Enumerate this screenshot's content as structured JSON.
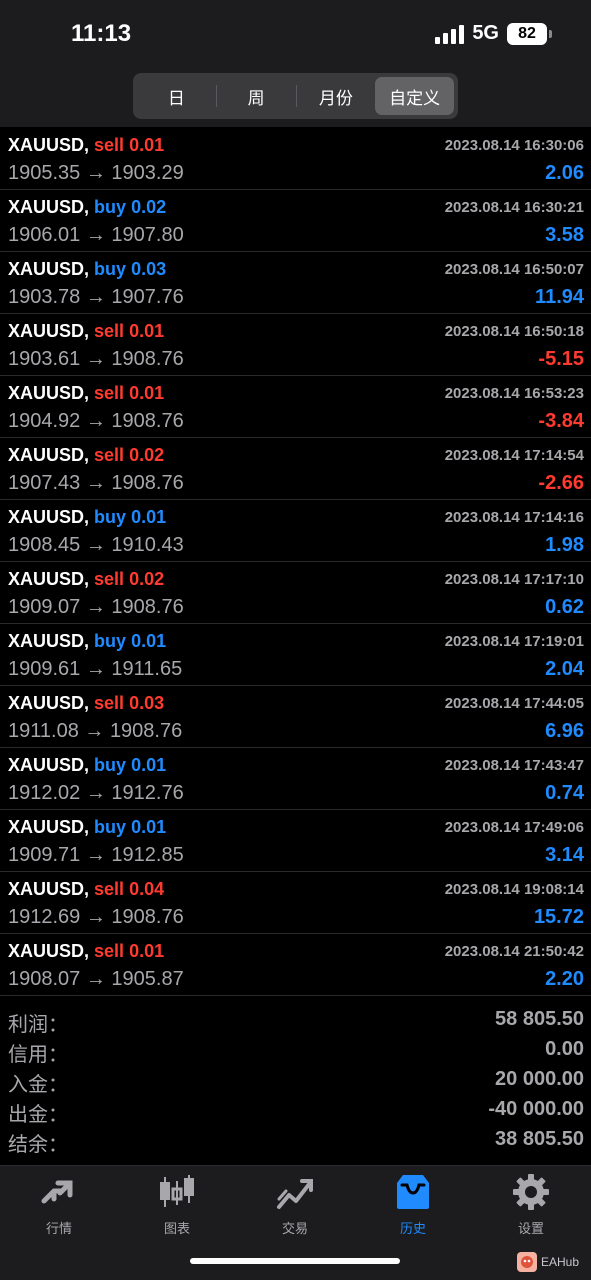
{
  "status": {
    "time": "11:13",
    "network": "5G",
    "battery": "82"
  },
  "segments": [
    {
      "label": "日",
      "active": false
    },
    {
      "label": "周",
      "active": false
    },
    {
      "label": "月份",
      "active": false
    },
    {
      "label": "自定义",
      "active": true
    }
  ],
  "trades": [
    {
      "symbol": "XAUUSD,",
      "side": "sell",
      "volume": "0.01",
      "time": "2023.08.14 16:30:06",
      "open": "1905.35",
      "arrow": "→",
      "close": "1903.29",
      "profit": "2.06",
      "profit_sign": "pos"
    },
    {
      "symbol": "XAUUSD,",
      "side": "buy",
      "volume": "0.02",
      "time": "2023.08.14 16:30:21",
      "open": "1906.01",
      "arrow": "→",
      "close": "1907.80",
      "profit": "3.58",
      "profit_sign": "pos"
    },
    {
      "symbol": "XAUUSD,",
      "side": "buy",
      "volume": "0.03",
      "time": "2023.08.14 16:50:07",
      "open": "1903.78",
      "arrow": "→",
      "close": "1907.76",
      "profit": "11.94",
      "profit_sign": "pos"
    },
    {
      "symbol": "XAUUSD,",
      "side": "sell",
      "volume": "0.01",
      "time": "2023.08.14 16:50:18",
      "open": "1903.61",
      "arrow": "→",
      "close": "1908.76",
      "profit": "-5.15",
      "profit_sign": "neg"
    },
    {
      "symbol": "XAUUSD,",
      "side": "sell",
      "volume": "0.01",
      "time": "2023.08.14 16:53:23",
      "open": "1904.92",
      "arrow": "→",
      "close": "1908.76",
      "profit": "-3.84",
      "profit_sign": "neg"
    },
    {
      "symbol": "XAUUSD,",
      "side": "sell",
      "volume": "0.02",
      "time": "2023.08.14 17:14:54",
      "open": "1907.43",
      "arrow": "→",
      "close": "1908.76",
      "profit": "-2.66",
      "profit_sign": "neg"
    },
    {
      "symbol": "XAUUSD,",
      "side": "buy",
      "volume": "0.01",
      "time": "2023.08.14 17:14:16",
      "open": "1908.45",
      "arrow": "→",
      "close": "1910.43",
      "profit": "1.98",
      "profit_sign": "pos"
    },
    {
      "symbol": "XAUUSD,",
      "side": "sell",
      "volume": "0.02",
      "time": "2023.08.14 17:17:10",
      "open": "1909.07",
      "arrow": "→",
      "close": "1908.76",
      "profit": "0.62",
      "profit_sign": "pos"
    },
    {
      "symbol": "XAUUSD,",
      "side": "buy",
      "volume": "0.01",
      "time": "2023.08.14 17:19:01",
      "open": "1909.61",
      "arrow": "→",
      "close": "1911.65",
      "profit": "2.04",
      "profit_sign": "pos"
    },
    {
      "symbol": "XAUUSD,",
      "side": "sell",
      "volume": "0.03",
      "time": "2023.08.14 17:44:05",
      "open": "1911.08",
      "arrow": "→",
      "close": "1908.76",
      "profit": "6.96",
      "profit_sign": "pos"
    },
    {
      "symbol": "XAUUSD,",
      "side": "buy",
      "volume": "0.01",
      "time": "2023.08.14 17:43:47",
      "open": "1912.02",
      "arrow": "→",
      "close": "1912.76",
      "profit": "0.74",
      "profit_sign": "pos"
    },
    {
      "symbol": "XAUUSD,",
      "side": "buy",
      "volume": "0.01",
      "time": "2023.08.14 17:49:06",
      "open": "1909.71",
      "arrow": "→",
      "close": "1912.85",
      "profit": "3.14",
      "profit_sign": "pos"
    },
    {
      "symbol": "XAUUSD,",
      "side": "sell",
      "volume": "0.04",
      "time": "2023.08.14 19:08:14",
      "open": "1912.69",
      "arrow": "→",
      "close": "1908.76",
      "profit": "15.72",
      "profit_sign": "pos"
    },
    {
      "symbol": "XAUUSD,",
      "side": "sell",
      "volume": "0.01",
      "time": "2023.08.14 21:50:42",
      "open": "1908.07",
      "arrow": "→",
      "close": "1905.87",
      "profit": "2.20",
      "profit_sign": "pos"
    }
  ],
  "summary": [
    {
      "label": "利润：",
      "value": "58 805.50"
    },
    {
      "label": "信用：",
      "value": "0.00"
    },
    {
      "label": "入金：",
      "value": "20 000.00"
    },
    {
      "label": "出金：",
      "value": "-40 000.00"
    },
    {
      "label": "结余：",
      "value": "38 805.50"
    }
  ],
  "tabs": [
    {
      "label": "行情",
      "icon": "quotes-icon",
      "active": false
    },
    {
      "label": "图表",
      "icon": "chart-icon",
      "active": false
    },
    {
      "label": "交易",
      "icon": "trade-icon",
      "active": false
    },
    {
      "label": "历史",
      "icon": "history-icon",
      "active": true
    },
    {
      "label": "设置",
      "icon": "settings-icon",
      "active": false
    }
  ],
  "watermark": {
    "text": "EAHub"
  },
  "colors": {
    "buy": "#1f8bff",
    "sell": "#ff3b30",
    "muted": "#a8a8ac",
    "active_tab": "#1f8bff"
  }
}
